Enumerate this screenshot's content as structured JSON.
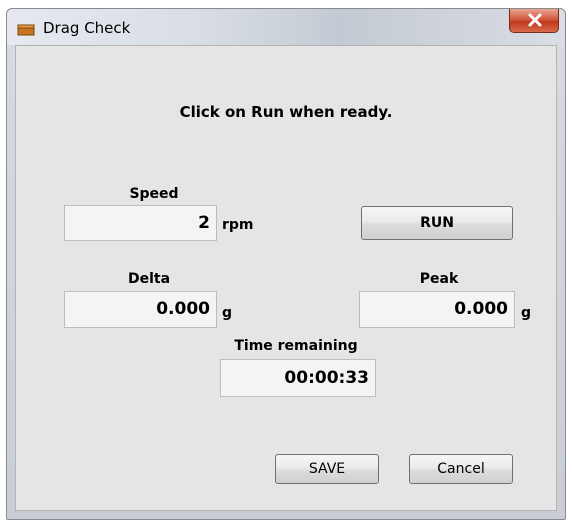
{
  "window": {
    "title": "Drag Check",
    "close_label": "X"
  },
  "instruction": "Click on Run when ready.",
  "speed": {
    "label": "Speed",
    "value": "2",
    "unit": "rpm"
  },
  "delta": {
    "label": "Delta",
    "value": "0.000",
    "unit": "g"
  },
  "peak": {
    "label": "Peak",
    "value": "0.000",
    "unit": "g"
  },
  "time_remaining": {
    "label": "Time remaining",
    "value": "00:00:33"
  },
  "buttons": {
    "run": "RUN",
    "save": "SAVE",
    "cancel": "Cancel"
  },
  "colors": {
    "close_button": "#c0391f",
    "client_background": "#e5e5e5",
    "field_background": "#f4f4f4"
  },
  "icons": {
    "app": "app-window-icon",
    "close": "close-x-icon"
  }
}
